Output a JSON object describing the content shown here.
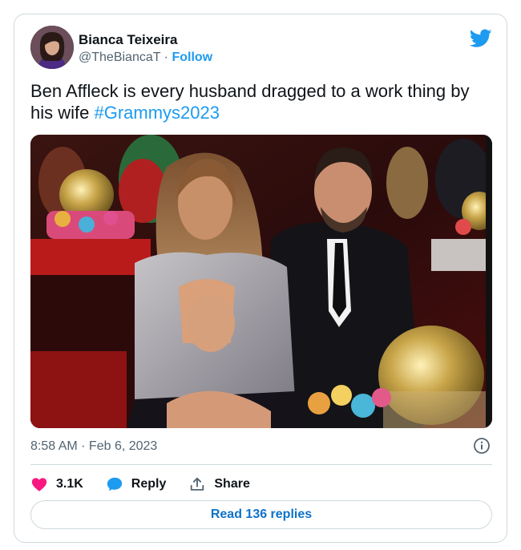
{
  "author": {
    "display_name": "Bianca Teixeira",
    "handle": "@TheBiancaT",
    "separator": "·",
    "follow_label": "Follow"
  },
  "tweet": {
    "text": "Ben Affleck is every husband dragged to a work thing by his wife ",
    "hashtag": "#Grammys2023"
  },
  "media": {
    "alt": "Photo of Jennifer Lopez and Ben Affleck seated at the Grammys"
  },
  "meta": {
    "timestamp": "8:58 AM · Feb 6, 2023"
  },
  "actions": {
    "like_count": "3.1K",
    "reply_label": "Reply",
    "share_label": "Share"
  },
  "footer": {
    "read_replies_label": "Read 136 replies"
  },
  "colors": {
    "accent": "#1d9bf0",
    "like": "#f91880",
    "text": "#0f1419",
    "muted": "#536471",
    "border": "#cfd9de"
  },
  "icons": {
    "brand": "twitter-bird-icon",
    "info": "info-icon",
    "like": "heart-icon",
    "reply": "speech-bubble-icon",
    "share": "upload-arrow-icon"
  }
}
